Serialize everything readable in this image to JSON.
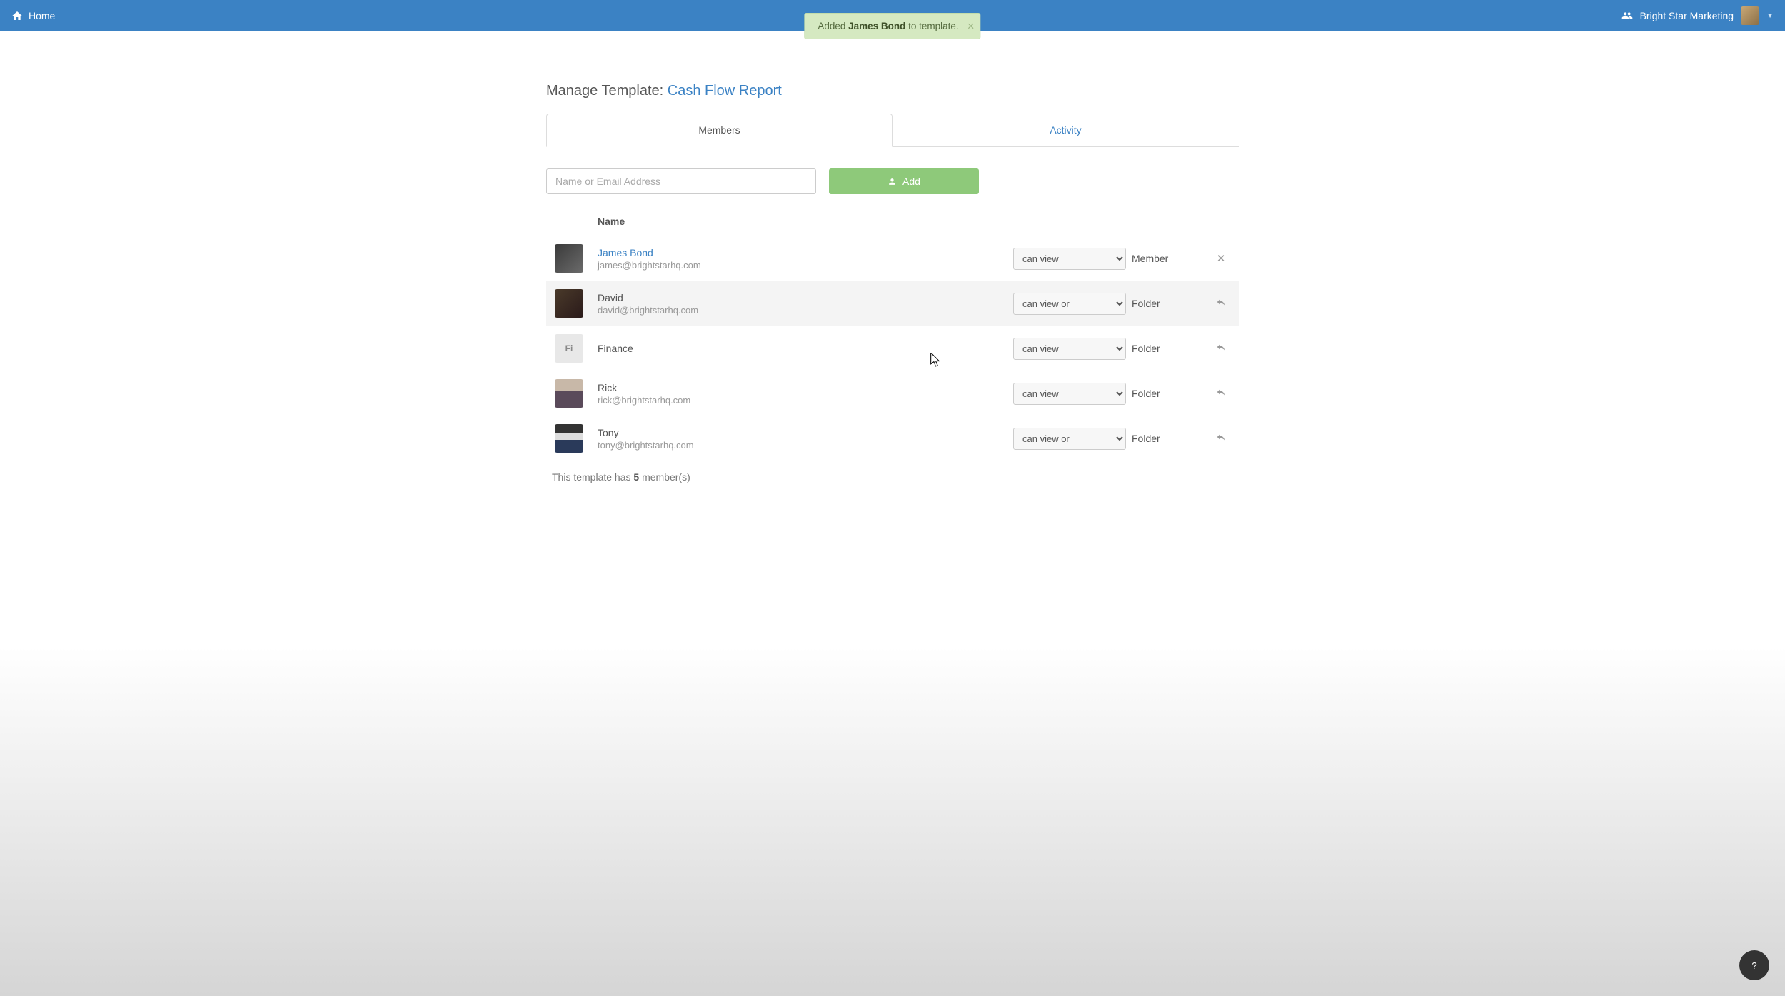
{
  "header": {
    "home": "Home",
    "org_name": "Bright Star Marketing"
  },
  "toast": {
    "prefix": "Added ",
    "name": "James Bond",
    "suffix": " to template."
  },
  "page": {
    "title_prefix": "Manage Template: ",
    "template_name": "Cash Flow Report"
  },
  "tabs": {
    "members": "Members",
    "activity": "Activity"
  },
  "add": {
    "placeholder": "Name or Email Address",
    "button": "Add"
  },
  "table": {
    "header_name": "Name",
    "rows": [
      {
        "name": "James Bond",
        "email": "james@brightstarhq.com",
        "name_link": true,
        "perm": "can view",
        "rel": "Member",
        "action": "remove",
        "avatar_text": ""
      },
      {
        "name": "David",
        "email": "david@brightstarhq.com",
        "name_link": false,
        "perm": "can view or",
        "rel": "Folder",
        "action": "reply",
        "avatar_text": ""
      },
      {
        "name": "Finance",
        "email": "",
        "name_link": false,
        "perm": "can view",
        "rel": "Folder",
        "action": "reply",
        "avatar_text": "Fi"
      },
      {
        "name": "Rick",
        "email": "rick@brightstarhq.com",
        "name_link": false,
        "perm": "can view",
        "rel": "Folder",
        "action": "reply",
        "avatar_text": ""
      },
      {
        "name": "Tony",
        "email": "tony@brightstarhq.com",
        "name_link": false,
        "perm": "can view or",
        "rel": "Folder",
        "action": "reply",
        "avatar_text": ""
      }
    ]
  },
  "footer": {
    "prefix": "This template has ",
    "count": "5",
    "suffix": " member(s)"
  },
  "help": {
    "label": "?"
  },
  "colors": {
    "primary": "#3b82c4",
    "success": "#8ec97a",
    "toast_bg": "#d5e9c1"
  }
}
